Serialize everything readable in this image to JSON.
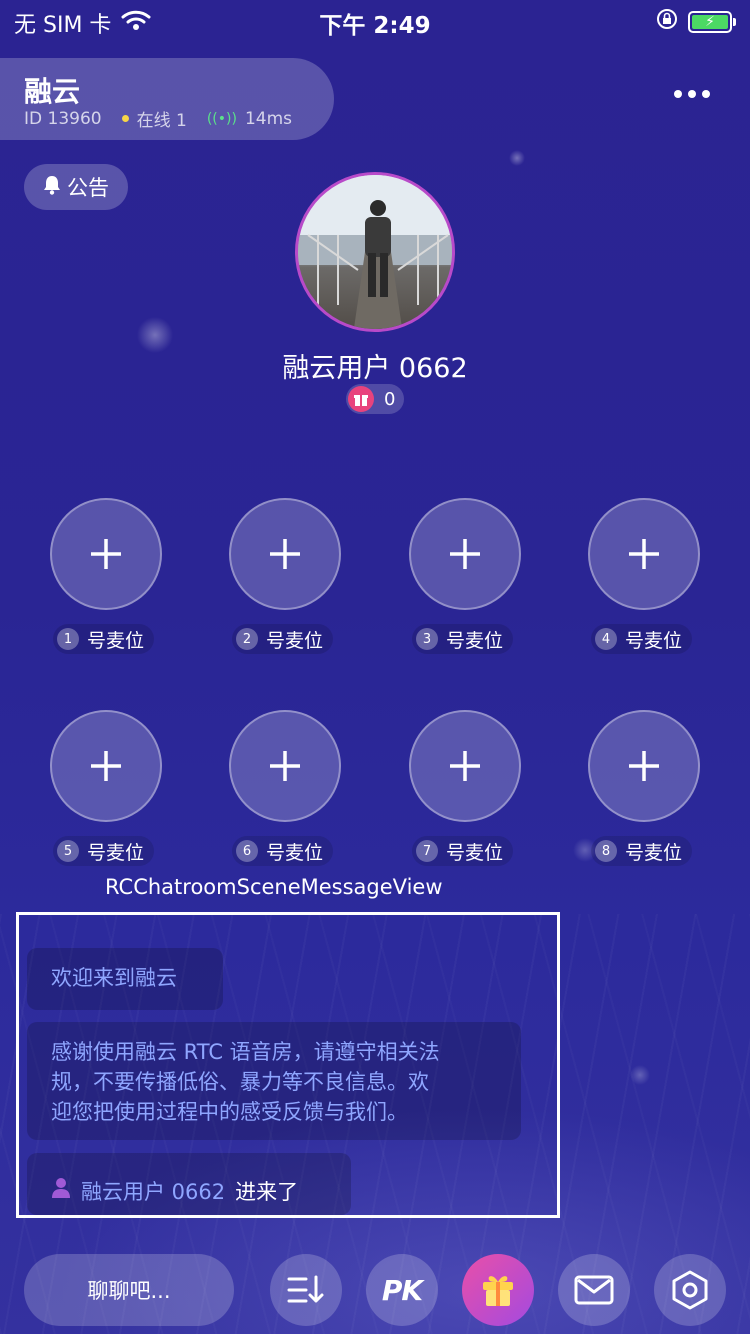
{
  "status_bar": {
    "carrier": "无 SIM 卡",
    "time": "下午 2:49"
  },
  "room": {
    "name": "融云",
    "id_text": "ID 13960",
    "online_text": "在线 1",
    "latency": "14ms"
  },
  "notice": {
    "label": "公告"
  },
  "host": {
    "name": "融云用户 0662",
    "gift_count": "0"
  },
  "seats": [
    {
      "number": "1",
      "label": "号麦位"
    },
    {
      "number": "2",
      "label": "号麦位"
    },
    {
      "number": "3",
      "label": "号麦位"
    },
    {
      "number": "4",
      "label": "号麦位"
    },
    {
      "number": "5",
      "label": "号麦位"
    },
    {
      "number": "6",
      "label": "号麦位"
    },
    {
      "number": "7",
      "label": "号麦位"
    },
    {
      "number": "8",
      "label": "号麦位"
    }
  ],
  "message_view": {
    "title": "RCChatroomSceneMessageView",
    "welcome": "欢迎来到融云",
    "notice_line1": "感谢使用融云 RTC 语音房，请遵守相关法",
    "notice_line2": "规，不要传播低俗、暴力等不良信息。欢",
    "notice_line3": "迎您把使用过程中的感受反馈与我们。",
    "join_user": "融云用户 0662",
    "join_suffix": "进来了"
  },
  "bottom_bar": {
    "chat_placeholder": "聊聊吧...",
    "pk_label": "PK"
  },
  "colors": {
    "background": "#2a2390",
    "message_text": "#8fa6ff",
    "gift_button": "#e94fa8",
    "online_dot": "#f7d547",
    "latency": "#5be08a"
  }
}
